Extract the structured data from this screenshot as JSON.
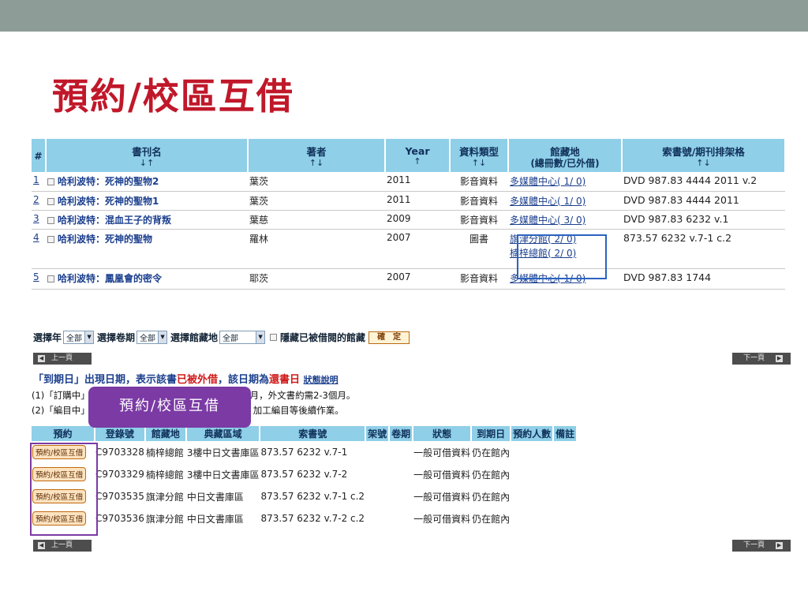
{
  "slide_title": "預約/校區互借",
  "results": {
    "headers": {
      "num": "#",
      "title": "書刊名",
      "title_arrows": "↓↑",
      "author": "著者",
      "author_arrows": "↑↓",
      "year": "Year",
      "year_arrows": "↑",
      "type": "資料類型",
      "type_arrows": "↑↓",
      "location": "館藏地",
      "location_sub": "(總冊數/已外借)",
      "callno": "索書號/期刊排架格",
      "callno_arrows": "↑↓"
    },
    "rows": [
      {
        "num": "1",
        "title": "哈利波特：死神的聖物2",
        "author": "葉茨",
        "year": "2011",
        "type": "影音資料",
        "locations": [
          "多媒體中心( 1/ 0)"
        ],
        "callno": "DVD 987.83 4444 2011 v.2"
      },
      {
        "num": "2",
        "title": "哈利波特：死神的聖物1",
        "author": "葉茨",
        "year": "2011",
        "type": "影音資料",
        "locations": [
          "多媒體中心( 1/ 0)"
        ],
        "callno": "DVD 987.83 4444 2011"
      },
      {
        "num": "3",
        "title": "哈利波特：混血王子的背叛",
        "author": "葉慈",
        "year": "2009",
        "type": "影音資料",
        "locations": [
          "多媒體中心( 3/ 0)"
        ],
        "callno": "DVD 987.83 6232 v.1"
      },
      {
        "num": "4",
        "title": "哈利波特：死神的聖物",
        "author": "羅林",
        "year": "2007",
        "type": "圖書",
        "locations": [
          "旗津分館( 2/ 0)",
          "楠梓總館( 2/ 0)"
        ],
        "callno": "873.57 6232 v.7-1 c.2"
      },
      {
        "num": "5",
        "title": "哈利波特：鳳凰會的密令",
        "author": "耶茨",
        "year": "2007",
        "type": "影音資料",
        "locations": [
          "多媒體中心( 1/ 0)"
        ],
        "callno": "DVD 987.83 1744"
      }
    ]
  },
  "filter": {
    "year_label": "選擇年",
    "year_value": "全部",
    "volume_label": "選擇卷期",
    "volume_value": "全部",
    "location_label": "選擇館藏地",
    "location_value": "全部",
    "hide_label": "隱藏已被借閱的館藏",
    "ok_label": "確　定"
  },
  "pager": {
    "prev": "上一頁",
    "next": "下一頁"
  },
  "legend": {
    "part1": "「到期日」出現日期，表示該書",
    "part2": "已被外借",
    "part3": "，該日期為",
    "part4": "還書日",
    "status_link": "狀態說明"
  },
  "notes": [
    "(1)「訂購中」…　　　　　　　　　　　　　約1-2個月，外文書約需2-3個月。",
    "(2)「編目中」…　　　　　　　　　　　　　理驗收、加工編目等後續作業。"
  ],
  "callout": "預約/校區互借",
  "holdings": {
    "headers": [
      "預約",
      "登錄號",
      "館藏地",
      "典藏區域",
      "索書號",
      "架號",
      "卷期",
      "狀態",
      "到期日",
      "預約人數",
      "備註"
    ],
    "reserve_label": "預約/校區互借",
    "rows": [
      {
        "barcode": "C9703328",
        "location": "楠梓總館",
        "area": "3樓中日文書庫區",
        "callno": "873.57 6232 v.7-1",
        "shelf": "",
        "volume": "",
        "status": "一般可借資料",
        "due": "仍在館內",
        "holds": "",
        "note": ""
      },
      {
        "barcode": "C9703329",
        "location": "楠梓總館",
        "area": "3樓中日文書庫區",
        "callno": "873.57 6232 v.7-2",
        "shelf": "",
        "volume": "",
        "status": "一般可借資料",
        "due": "仍在館內",
        "holds": "",
        "note": ""
      },
      {
        "barcode": "C9703535",
        "location": "旗津分館",
        "area": "中日文書庫區",
        "callno": "873.57 6232 v.7-1 c.2",
        "shelf": "",
        "volume": "",
        "status": "一般可借資料",
        "due": "仍在館內",
        "holds": "",
        "note": ""
      },
      {
        "barcode": "C9703536",
        "location": "旗津分館",
        "area": "中日文書庫區",
        "callno": "873.57 6232 v.7-2 c.2",
        "shelf": "",
        "volume": "",
        "status": "一般可借資料",
        "due": "仍在館內",
        "holds": "",
        "note": ""
      }
    ]
  },
  "colors": {
    "title": "#c0182a",
    "header_bg": "#8fcfe8",
    "callout": "#7b3aa4",
    "highlight": "#2a63c0"
  }
}
